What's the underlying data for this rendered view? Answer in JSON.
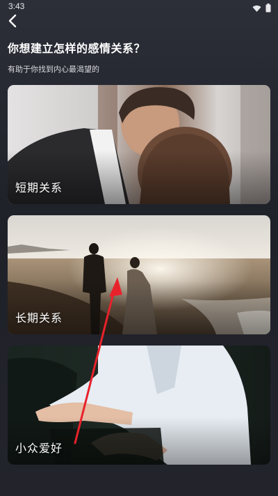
{
  "status_bar": {
    "time": "3:43",
    "icons": [
      "wifi-icon",
      "battery-icon"
    ]
  },
  "header": {
    "back_icon": "back-arrow-icon",
    "title": "你想建立怎样的感情关系？",
    "subtitle": "有助于你找到内心最渴望的"
  },
  "options": [
    {
      "label": "短期关系",
      "image": "couple-kissing-photo"
    },
    {
      "label": "长期关系",
      "image": "couple-beach-photo"
    },
    {
      "label": "小众爱好",
      "image": "person-white-shirt-photo"
    }
  ],
  "annotation": {
    "type": "arrow",
    "color": "#e8222b"
  }
}
